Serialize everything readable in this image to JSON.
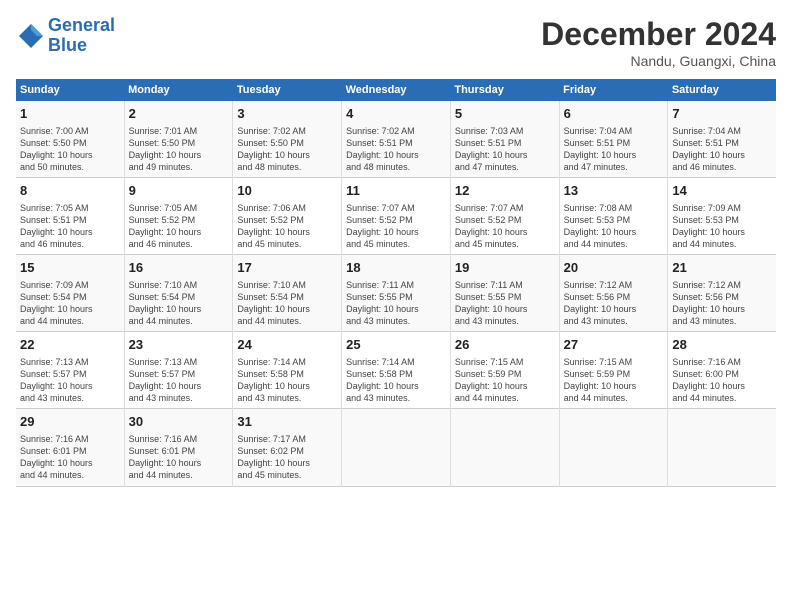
{
  "header": {
    "logo_line1": "General",
    "logo_line2": "Blue",
    "month": "December 2024",
    "location": "Nandu, Guangxi, China"
  },
  "days_of_week": [
    "Sunday",
    "Monday",
    "Tuesday",
    "Wednesday",
    "Thursday",
    "Friday",
    "Saturday"
  ],
  "weeks": [
    [
      {
        "day": "1",
        "info": "Sunrise: 7:00 AM\nSunset: 5:50 PM\nDaylight: 10 hours\nand 50 minutes."
      },
      {
        "day": "2",
        "info": "Sunrise: 7:01 AM\nSunset: 5:50 PM\nDaylight: 10 hours\nand 49 minutes."
      },
      {
        "day": "3",
        "info": "Sunrise: 7:02 AM\nSunset: 5:50 PM\nDaylight: 10 hours\nand 48 minutes."
      },
      {
        "day": "4",
        "info": "Sunrise: 7:02 AM\nSunset: 5:51 PM\nDaylight: 10 hours\nand 48 minutes."
      },
      {
        "day": "5",
        "info": "Sunrise: 7:03 AM\nSunset: 5:51 PM\nDaylight: 10 hours\nand 47 minutes."
      },
      {
        "day": "6",
        "info": "Sunrise: 7:04 AM\nSunset: 5:51 PM\nDaylight: 10 hours\nand 47 minutes."
      },
      {
        "day": "7",
        "info": "Sunrise: 7:04 AM\nSunset: 5:51 PM\nDaylight: 10 hours\nand 46 minutes."
      }
    ],
    [
      {
        "day": "8",
        "info": "Sunrise: 7:05 AM\nSunset: 5:51 PM\nDaylight: 10 hours\nand 46 minutes."
      },
      {
        "day": "9",
        "info": "Sunrise: 7:05 AM\nSunset: 5:52 PM\nDaylight: 10 hours\nand 46 minutes."
      },
      {
        "day": "10",
        "info": "Sunrise: 7:06 AM\nSunset: 5:52 PM\nDaylight: 10 hours\nand 45 minutes."
      },
      {
        "day": "11",
        "info": "Sunrise: 7:07 AM\nSunset: 5:52 PM\nDaylight: 10 hours\nand 45 minutes."
      },
      {
        "day": "12",
        "info": "Sunrise: 7:07 AM\nSunset: 5:52 PM\nDaylight: 10 hours\nand 45 minutes."
      },
      {
        "day": "13",
        "info": "Sunrise: 7:08 AM\nSunset: 5:53 PM\nDaylight: 10 hours\nand 44 minutes."
      },
      {
        "day": "14",
        "info": "Sunrise: 7:09 AM\nSunset: 5:53 PM\nDaylight: 10 hours\nand 44 minutes."
      }
    ],
    [
      {
        "day": "15",
        "info": "Sunrise: 7:09 AM\nSunset: 5:54 PM\nDaylight: 10 hours\nand 44 minutes."
      },
      {
        "day": "16",
        "info": "Sunrise: 7:10 AM\nSunset: 5:54 PM\nDaylight: 10 hours\nand 44 minutes."
      },
      {
        "day": "17",
        "info": "Sunrise: 7:10 AM\nSunset: 5:54 PM\nDaylight: 10 hours\nand 44 minutes."
      },
      {
        "day": "18",
        "info": "Sunrise: 7:11 AM\nSunset: 5:55 PM\nDaylight: 10 hours\nand 43 minutes."
      },
      {
        "day": "19",
        "info": "Sunrise: 7:11 AM\nSunset: 5:55 PM\nDaylight: 10 hours\nand 43 minutes."
      },
      {
        "day": "20",
        "info": "Sunrise: 7:12 AM\nSunset: 5:56 PM\nDaylight: 10 hours\nand 43 minutes."
      },
      {
        "day": "21",
        "info": "Sunrise: 7:12 AM\nSunset: 5:56 PM\nDaylight: 10 hours\nand 43 minutes."
      }
    ],
    [
      {
        "day": "22",
        "info": "Sunrise: 7:13 AM\nSunset: 5:57 PM\nDaylight: 10 hours\nand 43 minutes."
      },
      {
        "day": "23",
        "info": "Sunrise: 7:13 AM\nSunset: 5:57 PM\nDaylight: 10 hours\nand 43 minutes."
      },
      {
        "day": "24",
        "info": "Sunrise: 7:14 AM\nSunset: 5:58 PM\nDaylight: 10 hours\nand 43 minutes."
      },
      {
        "day": "25",
        "info": "Sunrise: 7:14 AM\nSunset: 5:58 PM\nDaylight: 10 hours\nand 43 minutes."
      },
      {
        "day": "26",
        "info": "Sunrise: 7:15 AM\nSunset: 5:59 PM\nDaylight: 10 hours\nand 44 minutes."
      },
      {
        "day": "27",
        "info": "Sunrise: 7:15 AM\nSunset: 5:59 PM\nDaylight: 10 hours\nand 44 minutes."
      },
      {
        "day": "28",
        "info": "Sunrise: 7:16 AM\nSunset: 6:00 PM\nDaylight: 10 hours\nand 44 minutes."
      }
    ],
    [
      {
        "day": "29",
        "info": "Sunrise: 7:16 AM\nSunset: 6:01 PM\nDaylight: 10 hours\nand 44 minutes."
      },
      {
        "day": "30",
        "info": "Sunrise: 7:16 AM\nSunset: 6:01 PM\nDaylight: 10 hours\nand 44 minutes."
      },
      {
        "day": "31",
        "info": "Sunrise: 7:17 AM\nSunset: 6:02 PM\nDaylight: 10 hours\nand 45 minutes."
      },
      {
        "day": "",
        "info": ""
      },
      {
        "day": "",
        "info": ""
      },
      {
        "day": "",
        "info": ""
      },
      {
        "day": "",
        "info": ""
      }
    ]
  ]
}
